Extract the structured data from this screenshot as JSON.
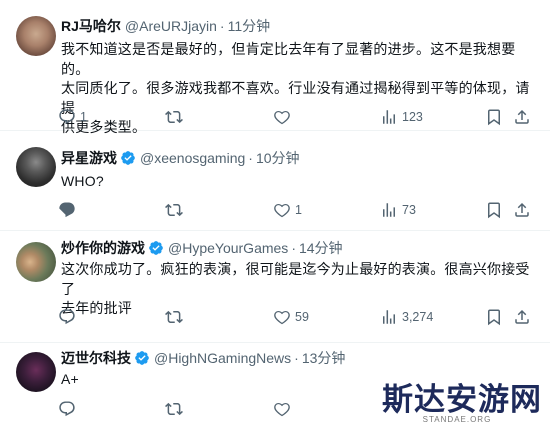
{
  "tweets": [
    {
      "name": "RJ马哈尔",
      "handle": "@AreURJjayin",
      "time": "11分钟",
      "text_lines": [
        "我不知道这是否是最好的，但肯定比去年有了显著的进步。这不是我想要的。",
        "太同质化了。很多游戏我都不喜欢。行业没有通过揭秘得到平等的体现，请提",
        "供更多类型。"
      ],
      "reply_count": "1",
      "like_count": "",
      "views": "123"
    },
    {
      "name": "异星游戏",
      "handle": "@xeenosgaming",
      "time": "10分钟",
      "text_lines": [
        "WHO?"
      ],
      "reply_count": "",
      "like_count": "1",
      "views": "73"
    },
    {
      "name": "炒作你的游戏",
      "handle": "@HypeYourGames",
      "time": "14分钟",
      "text_lines": [
        "这次你成功了。疯狂的表演，很可能是迄今为止最好的表演。很高兴你接受了",
        "去年的批评"
      ],
      "reply_count": "",
      "like_count": "59",
      "views": "3,274"
    },
    {
      "name": "迈世尔科技",
      "handle": "@HighNGamingNews",
      "time": "13分钟",
      "text_lines": [
        "A+"
      ],
      "reply_count": "",
      "like_count": "",
      "views": ""
    }
  ],
  "dot": "·",
  "watermark": {
    "main": "斯达安游网",
    "sub": "STANDAE.ORG"
  },
  "colors": {
    "accent": "#1d9bf0",
    "secondary_text": "#536471",
    "divider": "#eff3f4"
  }
}
